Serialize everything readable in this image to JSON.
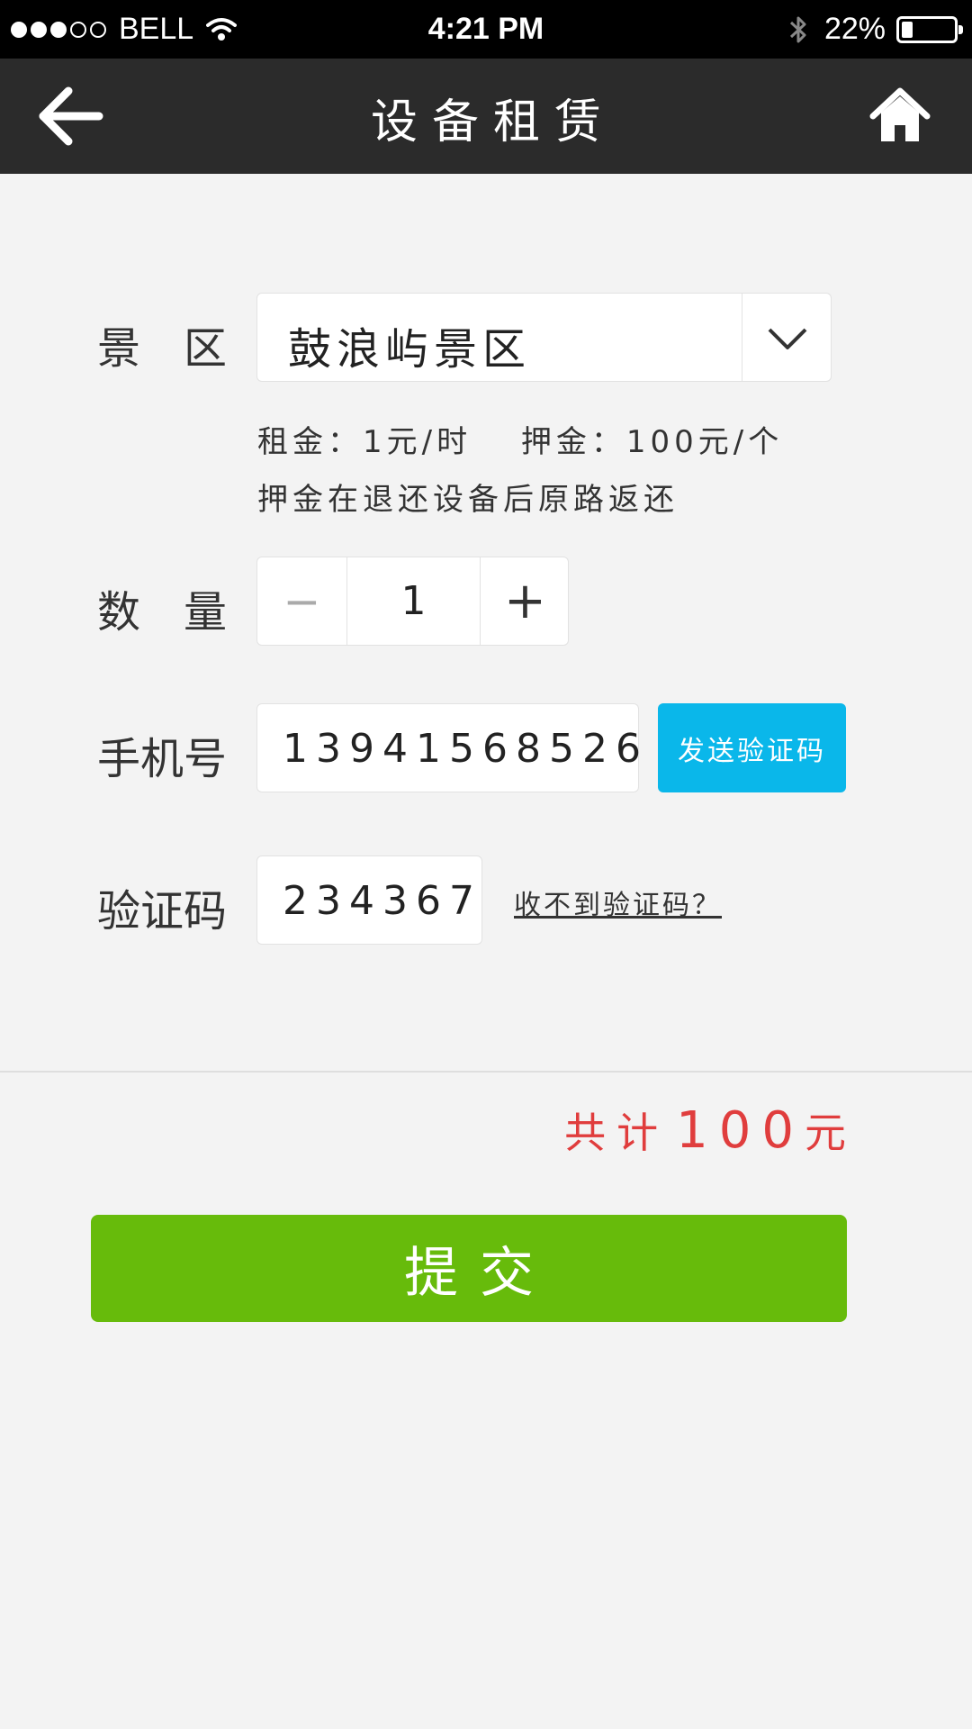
{
  "status_bar": {
    "carrier": "BELL",
    "time": "4:21 PM",
    "battery": "22%",
    "battery_level": 0.22,
    "signal_bars_filled": 3,
    "signal_bars_total": 5
  },
  "header": {
    "title": "设备租赁",
    "back_icon": "arrow-left-icon",
    "home_icon": "home-icon"
  },
  "form": {
    "scenic_area": {
      "label": "景　区",
      "value": "鼓浪屿景区",
      "dropdown_icon": "chevron-down-icon"
    },
    "pricing_line": "租金：1元/时　 押金：100元/个",
    "deposit_note": "押金在退还设备后原路返还",
    "quantity": {
      "label": "数　量",
      "minus": "−",
      "value": "1",
      "plus": "+"
    },
    "phone": {
      "label": "手机号",
      "value": "13941568526",
      "send_code_label": "发送验证码"
    },
    "verification": {
      "label": "验证码",
      "value": "234367",
      "help_link": "收不到验证码？"
    }
  },
  "summary": {
    "total_prefix": "共计",
    "total_amount": "100",
    "total_unit": "元"
  },
  "submit_label": "提交",
  "colors": {
    "nav_background": "#2b2b2b",
    "send_code_button": "#0ab7ea",
    "submit_button": "#67bb0b",
    "total_text": "#e03d3d",
    "page_background": "#f3f3f3"
  }
}
